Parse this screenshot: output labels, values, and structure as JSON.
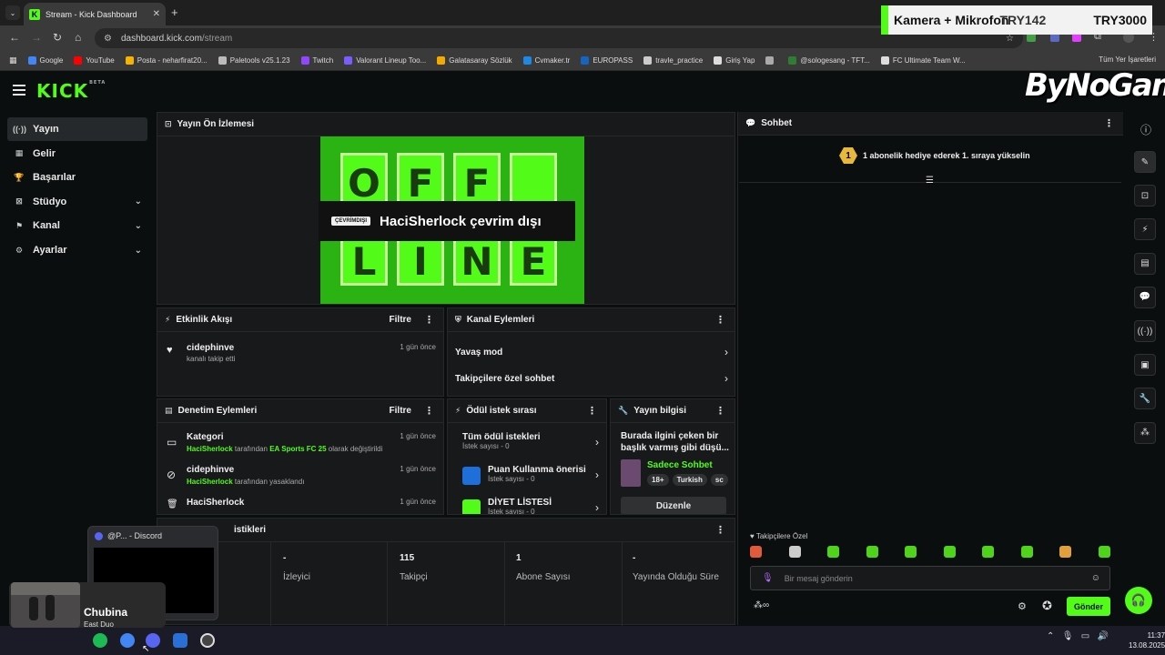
{
  "browser": {
    "tab_title": "Stream - Kick Dashboard",
    "tab_favicon": "K",
    "tab_close": "✕",
    "new_tab": "+",
    "tab_menu": "⌄",
    "url_host": "dashboard.kick.com",
    "url_path": "/stream",
    "nav": {
      "back": "←",
      "forward": "→",
      "reload": "↻",
      "home": "⌂"
    },
    "bookmarks": [
      {
        "label": "Google",
        "color": "#4285f4"
      },
      {
        "label": "YouTube",
        "color": "#ff0000"
      },
      {
        "label": "Posta - neharfirat20...",
        "color": "#f4b400"
      },
      {
        "label": "Paletools v25.1.23",
        "color": "#bbbbbb"
      },
      {
        "label": "Twitch",
        "color": "#9146ff"
      },
      {
        "label": "Valorant Lineup Too...",
        "color": "#7b5cff"
      },
      {
        "label": "Galatasaray Sözlük",
        "color": "#f2a900"
      },
      {
        "label": "Cvmaker.tr",
        "color": "#1e88e5"
      },
      {
        "label": "EUROPASS",
        "color": "#1565c0"
      },
      {
        "label": "travle_practice",
        "color": "#cccccc"
      },
      {
        "label": "Giriş Yap",
        "color": "#dddddd"
      },
      {
        "label": "",
        "color": "#aaaaaa"
      },
      {
        "label": "@sologesang - TFT...",
        "color": "#2e7d32"
      },
      {
        "label": "FC Ultimate Team W...",
        "color": "#dddddd"
      }
    ],
    "bookmarks_all": "Tüm Yer İşaretleri"
  },
  "overlay": {
    "text1": "Kamera + Mikrofon",
    "text2": "TRY142",
    "text3": "TRY3000"
  },
  "kick": {
    "logo": "KICK",
    "logo_sup": "BETA",
    "watermark": "ByNoGame"
  },
  "sidebar": {
    "items": [
      {
        "label": "Yayın",
        "icon": "((·))",
        "chevron": ""
      },
      {
        "label": "Gelir",
        "icon": "▦",
        "chevron": ""
      },
      {
        "label": "Başarılar",
        "icon": "🏆",
        "chevron": ""
      },
      {
        "label": "Stüdyo",
        "icon": "⊠",
        "chevron": "⌄"
      },
      {
        "label": "Kanal",
        "icon": "⚑",
        "chevron": "⌄"
      },
      {
        "label": "Ayarlar",
        "icon": "⚙",
        "chevron": "⌄"
      }
    ]
  },
  "preview": {
    "title": "Yayın Ön İzlemesi",
    "offline_badge": "ÇEVRİMDIŞI",
    "offline_text": "HaciSherlock çevrim dışı",
    "letters_top": [
      "O",
      "F",
      "F",
      ""
    ],
    "letters_bottom": [
      "L",
      "I",
      "N",
      "E"
    ]
  },
  "activity": {
    "title": "Etkinlik Akışı",
    "filter": "Filtre",
    "items": [
      {
        "name": "cidephinve",
        "desc": "kanalı takip etti",
        "time": "1 gün önce"
      }
    ]
  },
  "channel_actions": {
    "title": "Kanal Eylemleri",
    "items": [
      {
        "label": "Yavaş mod"
      },
      {
        "label": "Takipçilere özel sohbet"
      }
    ]
  },
  "moderation": {
    "title": "Denetim Eylemleri",
    "filter": "Filtre",
    "items": [
      {
        "title": "Kategori",
        "actor": "HaciSherlock",
        "mid": " tarafından ",
        "target": "EA Sports FC 25",
        "end": " olarak değiştirildi",
        "time": "1 gün önce",
        "icon": "▭"
      },
      {
        "title": "cidephinve",
        "actor": "HaciSherlock",
        "mid": " tarafından yasaklandı",
        "target": "",
        "end": "",
        "time": "1 gün önce",
        "icon": "⊘"
      },
      {
        "title": "HaciSherlock",
        "actor": "",
        "mid": "",
        "target": "",
        "end": "",
        "time": "1 gün önce",
        "icon": "🗑"
      }
    ]
  },
  "rewards": {
    "title": "Ödül istek sırası",
    "items": [
      {
        "title": "Tüm ödül istekleri",
        "sub": "İstek sayısı - 0"
      },
      {
        "title": "Puan Kullanma önerisi",
        "sub": "İstek sayısı - 0"
      },
      {
        "title": "DİYET LİSTESİ",
        "sub": "İstek sayısı - 0"
      }
    ]
  },
  "stream_info": {
    "title": "Yayın bilgisi",
    "desc": "Burada ilgini çeken bir başlık varmış gibi düşü...",
    "category": "Sadece Sohbet",
    "tags": [
      "18+",
      "Turkish",
      "sc"
    ],
    "edit": "Düzenle"
  },
  "stats": {
    "title": "istikleri",
    "items": [
      {
        "value": "-",
        "label": "İzleyici"
      },
      {
        "value": "115",
        "label": "Takipçi"
      },
      {
        "value": "1",
        "label": "Abone Sayısı"
      },
      {
        "value": "-",
        "label": "Yayında Olduğu Süre"
      }
    ]
  },
  "chat": {
    "title": "Sohbet",
    "banner_badge": "1",
    "banner_text": "1 abonelik hediye ederek 1. sıraya yükselin",
    "mode": "Takipçilere Özel",
    "placeholder": "Bir mesaj gönderin",
    "send": "Gönder",
    "emote_colors": [
      "#e05a3c",
      "#cccccc",
      "#4fd41b",
      "#4fd41b",
      "#4fd41b",
      "#4fd41b",
      "#4fd41b",
      "#4fd41b",
      "#e0a03c",
      "#4fd41b"
    ]
  },
  "rail": {
    "icons": [
      "info-icon",
      "pencil-icon",
      "focus-icon",
      "bolt-icon",
      "document-icon",
      "chat-bubble-icon",
      "broadcast-icon",
      "video-icon",
      "wrench-icon",
      "apps-icon"
    ]
  },
  "media": {
    "song": "Chubina",
    "artist": "East Duo"
  },
  "discord": {
    "title": "@P... - Discord"
  },
  "taskbar": {
    "time": "11:37",
    "date": "13.08.2025"
  },
  "colors": {
    "accent": "#53fc18",
    "panel": "#18191b",
    "background": "#0b0e0f"
  }
}
